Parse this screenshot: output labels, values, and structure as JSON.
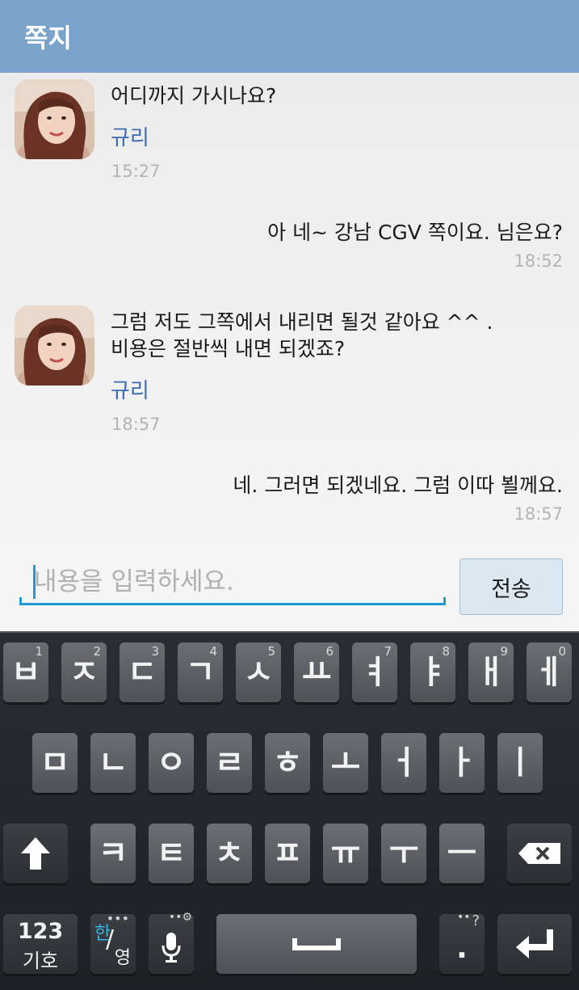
{
  "header": {
    "title": "쪽지"
  },
  "messages": [
    {
      "text": "어디까지 가시나요?",
      "sender": "규리",
      "time": "15:27"
    },
    {
      "text": "아 네~ 강남 CGV 쪽이요. 님은요?",
      "time": "18:52"
    },
    {
      "text_line1": "그럼 저도 그쪽에서 내리면 될것 같아요 ^^ .",
      "text_line2": "비용은 절반씩 내면 되겠죠?",
      "sender": "규리",
      "time": "18:57"
    },
    {
      "text": "네. 그러면 되겠네요. 그럼 이따 뵐께요.",
      "time": "18:57"
    }
  ],
  "composer": {
    "placeholder": "내용을 입력하세요.",
    "send_label": "전송"
  },
  "keyboard": {
    "row1": [
      {
        "key": "ㅂ",
        "hint": "1"
      },
      {
        "key": "ㅈ",
        "hint": "2"
      },
      {
        "key": "ㄷ",
        "hint": "3"
      },
      {
        "key": "ㄱ",
        "hint": "4"
      },
      {
        "key": "ㅅ",
        "hint": "5"
      },
      {
        "key": "ㅛ",
        "hint": "6"
      },
      {
        "key": "ㅕ",
        "hint": "7"
      },
      {
        "key": "ㅑ",
        "hint": "8"
      },
      {
        "key": "ㅐ",
        "hint": "9"
      },
      {
        "key": "ㅔ",
        "hint": "0"
      }
    ],
    "row2": [
      "ㅁ",
      "ㄴ",
      "ㅇ",
      "ㄹ",
      "ㅎ",
      "ㅗ",
      "ㅓ",
      "ㅏ",
      "ㅣ"
    ],
    "row3": [
      "ㅋ",
      "ㅌ",
      "ㅊ",
      "ㅍ",
      "ㅠ",
      "ㅜ",
      "ㅡ"
    ],
    "symbols_key": {
      "line1": "123",
      "line2": "기호"
    },
    "lang_key": {
      "line1": "한",
      "line2": "영"
    },
    "period_key": {
      "label": ".",
      "hint": "?"
    },
    "icons": {
      "shift": "shift-arrow-icon",
      "backspace": "backspace-icon",
      "mic": "microphone-icon",
      "space": "space-bar-icon",
      "enter": "enter-return-icon"
    }
  },
  "colors": {
    "appbar": "#7aa3cc",
    "accent": "#1f9ad6",
    "sender_name": "#3b6bb0",
    "time": "#b4b4b4"
  }
}
